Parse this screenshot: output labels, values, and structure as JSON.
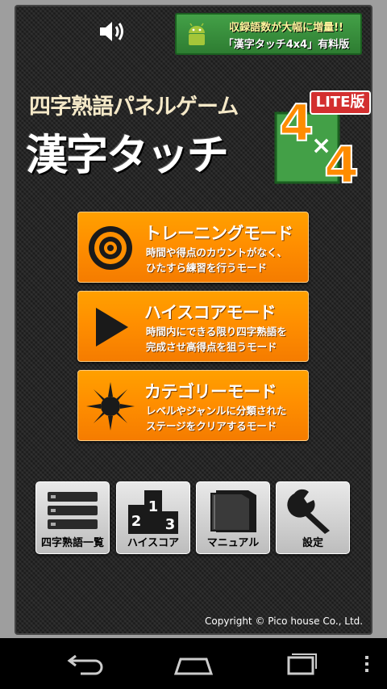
{
  "promo": {
    "line1": "収録語数が大幅に増量!!",
    "line2": "「漢字タッチ4x4」有料版"
  },
  "header": {
    "subtitle": "四字熟語パネルゲーム",
    "title": "漢字タッチ",
    "logo_top": "4",
    "logo_times": "×",
    "logo_bottom": "4",
    "lite_badge": "LITE版"
  },
  "modes": [
    {
      "title": "トレーニングモード",
      "desc1": "時間や得点のカウントがなく、",
      "desc2": "ひたすら練習を行うモード",
      "icon": "target-icon"
    },
    {
      "title": "ハイスコアモード",
      "desc1": "時間内にできる限り四字熟語を",
      "desc2": "完成させ高得点を狙うモード",
      "icon": "play-icon"
    },
    {
      "title": "カテゴリーモード",
      "desc1": "レベルやジャンルに分類された",
      "desc2": "ステージをクリアするモード",
      "icon": "sun-icon"
    }
  ],
  "tiles": [
    {
      "label": "四字熟語一覧",
      "icon": "list-icon"
    },
    {
      "label": "ハイスコア",
      "icon": "podium-icon"
    },
    {
      "label": "マニュアル",
      "icon": "manual-icon"
    },
    {
      "label": "設定",
      "icon": "wrench-icon"
    }
  ],
  "podium": {
    "first": "1",
    "second": "2",
    "third": "3"
  },
  "copyright": "Copyright © Pico house Co., Ltd.",
  "colors": {
    "accent_orange": "#ff8f00",
    "promo_green": "#388e3c",
    "logo_orange": "#ff8c00",
    "lite_red": "#d32f2f"
  }
}
